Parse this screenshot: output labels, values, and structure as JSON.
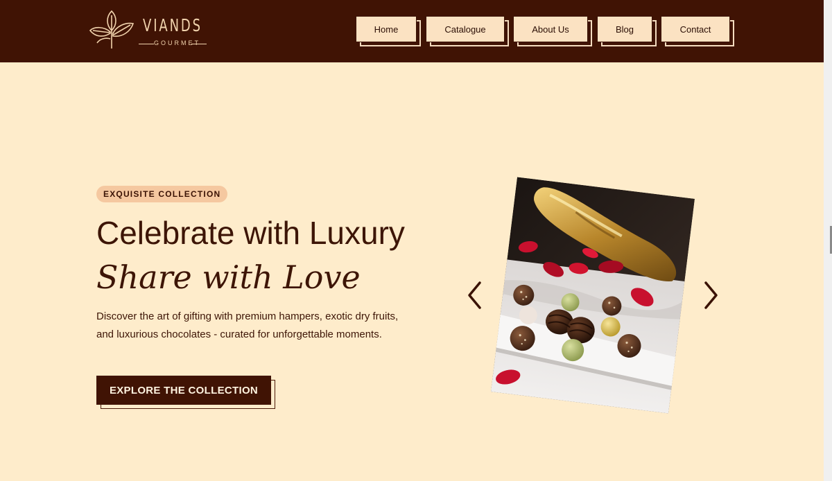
{
  "brand": {
    "name": "VIANDS",
    "tagline": "GOURMET",
    "logo_icon": "leaf-sprig-icon"
  },
  "nav": {
    "items": [
      {
        "label": "Home"
      },
      {
        "label": "Catalogue"
      },
      {
        "label": "About Us"
      },
      {
        "label": "Blog"
      },
      {
        "label": "Contact"
      }
    ]
  },
  "hero": {
    "badge": "EXQUISITE COLLECTION",
    "title": "Celebrate with Luxury",
    "subtitle": "Share with Love",
    "description": "Discover the art of gifting with premium hampers, exotic dry fruits, and luxurious chocolates - curated for unforgettable moments.",
    "cta_label": "EXPLORE THE COLLECTION"
  },
  "carousel": {
    "prev_icon": "chevron-left-icon",
    "next_icon": "chevron-right-icon"
  },
  "colors": {
    "header_bg": "#401304",
    "page_bg": "#feeccb",
    "nav_button_bg": "#fbe2c2",
    "badge_bg": "#f5c8a0",
    "text_dark": "#3d1506"
  }
}
